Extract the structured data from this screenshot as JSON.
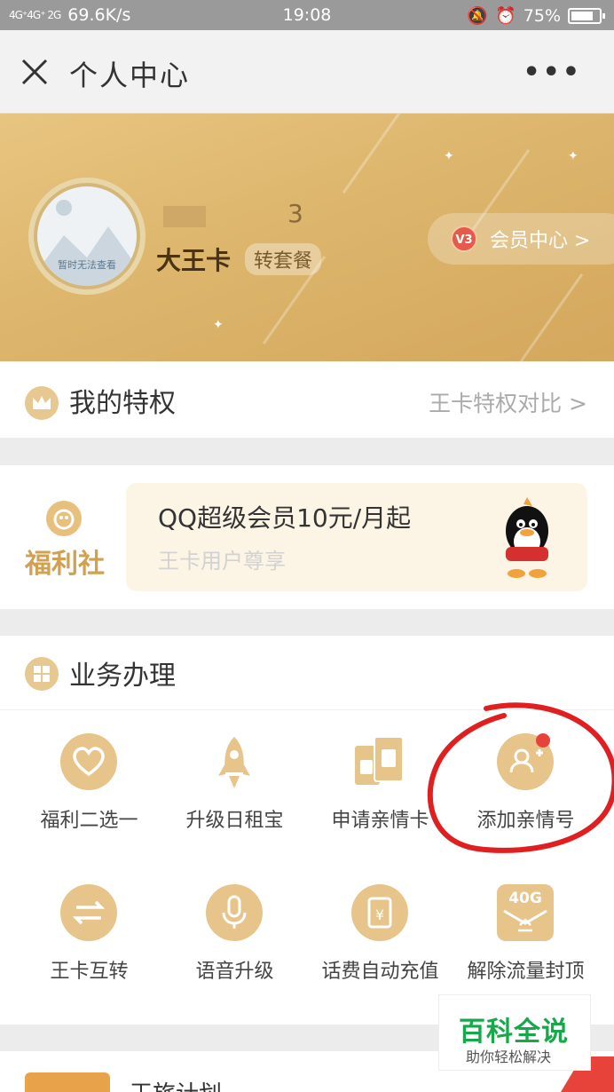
{
  "status_bar": {
    "signal": "4G⁺4G⁺ 2G",
    "speed": "69.6K/s",
    "time": "19:08",
    "battery": "75%"
  },
  "nav": {
    "title": "个人中心",
    "more": "•••"
  },
  "profile": {
    "avatar_placeholder": "暂时无法查看",
    "username_tail": "3",
    "plan_name": "大王卡",
    "switch_plan": "转套餐",
    "vip_badge": "V3",
    "member_center": "会员中心 >"
  },
  "privilege": {
    "title": "我的特权",
    "compare": "王卡特权对比 >"
  },
  "welfare": {
    "label": "福利社",
    "title": "QQ超级会员10元/月起",
    "subtitle": "王卡用户尊享"
  },
  "business": {
    "title": "业务办理",
    "items": [
      {
        "label": "福利二选一",
        "icon": "heart-icon"
      },
      {
        "label": "升级日租宝",
        "icon": "rocket-icon"
      },
      {
        "label": "申请亲情卡",
        "icon": "sim-card-icon"
      },
      {
        "label": "添加亲情号",
        "icon": "add-user-icon"
      },
      {
        "label": "王卡互转",
        "icon": "transfer-icon"
      },
      {
        "label": "语音升级",
        "icon": "microphone-icon"
      },
      {
        "label": "话费自动充值",
        "icon": "recharge-icon"
      },
      {
        "label": "解除流量封顶",
        "icon": "data-40g-icon"
      }
    ],
    "data_badge": "40G"
  },
  "bottom": {
    "title": "王旅计划"
  },
  "watermark": {
    "title": "百科全说",
    "subtitle": "助你轻松解决"
  },
  "colors": {
    "gold": "#dcb46b",
    "icon_gold": "#e6c48a",
    "red": "#e8433a",
    "green": "#17a84a"
  }
}
